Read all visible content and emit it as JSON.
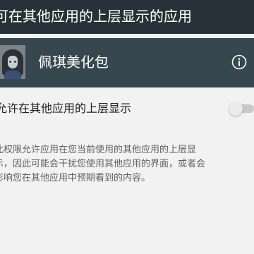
{
  "header": {
    "title": "可在其他应用的上层显示的应用"
  },
  "app": {
    "name": "佩琪美化包",
    "icon": "app-avatar-icon",
    "info_icon": "info-icon"
  },
  "setting": {
    "label": "允许在其他应用的上层显示",
    "toggle_state": "off"
  },
  "description": {
    "text": "此权限允许应用在您当前使用的其他应用的上层显\n示，因此可能会干扰您使用其他应用的界面，或者会\n影响您在其他应用中预期看到的内容。"
  },
  "colors": {
    "topbar": "#263238",
    "appbar": "#37474f",
    "background": "#f2f2f2",
    "toggle_track_off": "#c8c8c8"
  }
}
